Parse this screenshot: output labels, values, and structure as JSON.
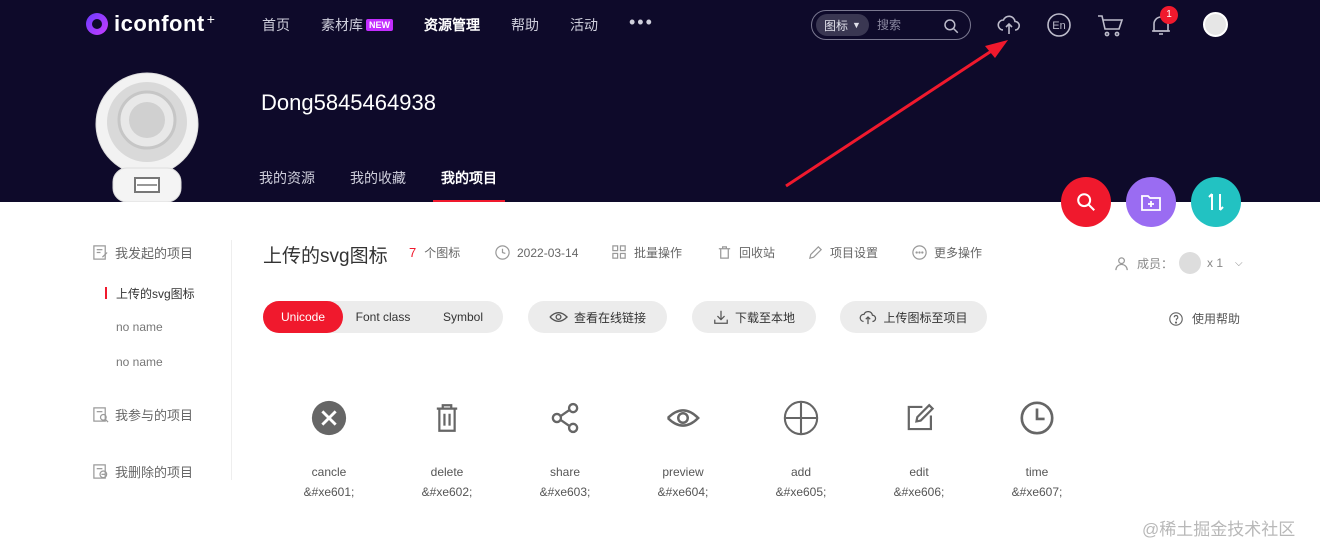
{
  "logo": {
    "text": "iconfont",
    "plus": "+"
  },
  "nav": [
    {
      "label": "首页"
    },
    {
      "label": "素材库",
      "badge": "NEW"
    },
    {
      "label": "资源管理",
      "active": true
    },
    {
      "label": "帮助"
    },
    {
      "label": "活动"
    }
  ],
  "nav_more": "•••",
  "search": {
    "type": "图标",
    "placeholder": "搜索"
  },
  "notifications": {
    "count": "1"
  },
  "profile": {
    "username": "Dong5845464938"
  },
  "sub_tabs": [
    {
      "label": "我的资源"
    },
    {
      "label": "我的收藏"
    },
    {
      "label": "我的项目",
      "active": true
    }
  ],
  "sidebar": {
    "created": "我发起的项目",
    "projects": [
      "上传的svg图标",
      "no name",
      "no name"
    ],
    "joined": "我参与的项目",
    "deleted": "我删除的项目"
  },
  "project": {
    "title": "上传的svg图标",
    "icon_count": "7",
    "icon_count_label": "个图标",
    "date": "2022-03-14",
    "batch": "批量操作",
    "recycle": "回收站",
    "settings": "项目设置",
    "more": "更多操作",
    "members_label": "成员：",
    "members_count": "x 1"
  },
  "toolbar": {
    "seg": [
      "Unicode",
      "Font class",
      "Symbol"
    ],
    "view_link": "查看在线链接",
    "download": "下载至本地",
    "upload": "上传图标至项目",
    "help": "使用帮助"
  },
  "icons": [
    {
      "name": "cancle",
      "code": "&#xe601;",
      "icon": "cancel-icon"
    },
    {
      "name": "delete",
      "code": "&#xe602;",
      "icon": "trash-icon"
    },
    {
      "name": "share",
      "code": "&#xe603;",
      "icon": "share-icon"
    },
    {
      "name": "preview",
      "code": "&#xe604;",
      "icon": "eye-icon"
    },
    {
      "name": "add",
      "code": "&#xe605;",
      "icon": "plus-circle-icon"
    },
    {
      "name": "edit",
      "code": "&#xe606;",
      "icon": "edit-icon"
    },
    {
      "name": "time",
      "code": "&#xe607;",
      "icon": "clock-icon"
    }
  ],
  "watermark": "@稀土掘金技术社区",
  "colors": {
    "header_bg": "#0e0a2a",
    "accent_red": "#f0192d",
    "purple": "#9a6cf2",
    "teal": "#22c2c2"
  }
}
